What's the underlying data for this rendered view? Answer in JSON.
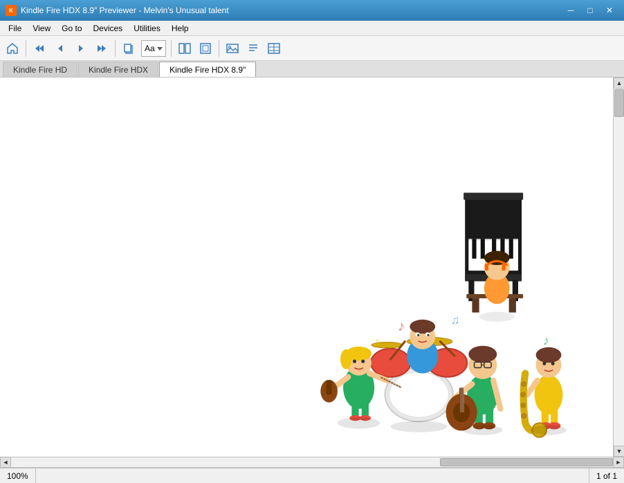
{
  "titlebar": {
    "icon_label": "K",
    "title": "Kindle Fire HDX 8.9\" Previewer - Melvin's Unusual talent",
    "minimize": "─",
    "maximize": "□",
    "close": "✕"
  },
  "menubar": {
    "items": [
      {
        "id": "file",
        "label": "File"
      },
      {
        "id": "view",
        "label": "View"
      },
      {
        "id": "goto",
        "label": "Go to"
      },
      {
        "id": "devices",
        "label": "Devices"
      },
      {
        "id": "utilities",
        "label": "Utilities"
      },
      {
        "id": "help",
        "label": "Help"
      }
    ]
  },
  "toolbar": {
    "buttons": [
      {
        "id": "home",
        "icon": "🏠",
        "label": "Home"
      },
      {
        "id": "back-start",
        "icon": "⏮",
        "label": "Go to start"
      },
      {
        "id": "back",
        "icon": "◀",
        "label": "Back"
      },
      {
        "id": "forward",
        "icon": "▶",
        "label": "Forward"
      },
      {
        "id": "forward-end",
        "icon": "⏭",
        "label": "Go to end"
      },
      {
        "id": "sep1"
      },
      {
        "id": "copy",
        "icon": "📋",
        "label": "Copy"
      },
      {
        "id": "font",
        "label": "Font",
        "is_font": true
      },
      {
        "id": "sep2"
      },
      {
        "id": "page-view",
        "icon": "▭",
        "label": "Page view"
      },
      {
        "id": "fit-page",
        "icon": "⊞",
        "label": "Fit page"
      },
      {
        "id": "sep3"
      },
      {
        "id": "image",
        "icon": "🖼",
        "label": "Image"
      },
      {
        "id": "text",
        "icon": "≡",
        "label": "Text"
      },
      {
        "id": "table",
        "icon": "⊞",
        "label": "Table"
      }
    ],
    "font_label": "Aa"
  },
  "tabs": [
    {
      "id": "kindle-hd",
      "label": "Kindle Fire HD",
      "active": false
    },
    {
      "id": "kindle-hdx",
      "label": "Kindle Fire HDX",
      "active": false
    },
    {
      "id": "kindle-hdx-89",
      "label": "Kindle Fire HDX 8.9\"",
      "active": true
    }
  ],
  "statusbar": {
    "zoom": "100%",
    "page_label": "1 of 1"
  },
  "scrollbar": {
    "up": "▲",
    "down": "▼",
    "left": "◄",
    "right": "►"
  }
}
